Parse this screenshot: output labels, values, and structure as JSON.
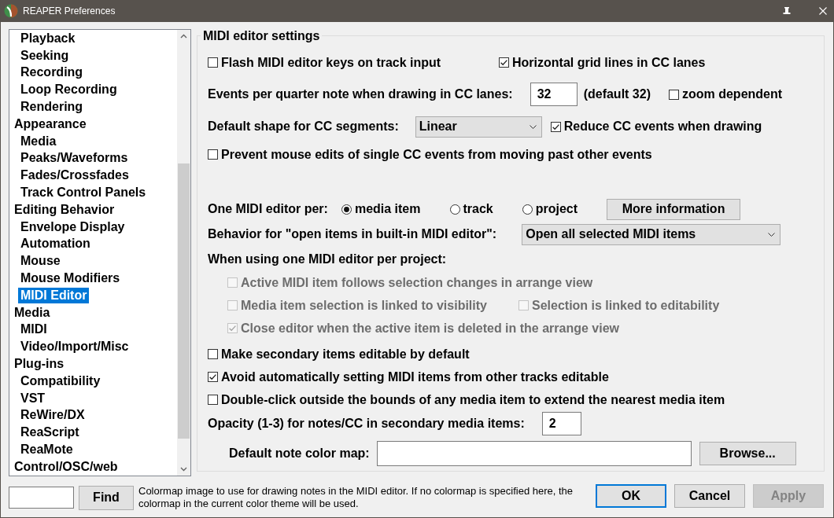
{
  "window": {
    "title": "REAPER Preferences"
  },
  "tree": [
    {
      "children": [
        {
          "label": "Playback",
          "selected": false
        },
        {
          "label": "Seeking",
          "selected": false
        },
        {
          "label": "Recording",
          "selected": false
        },
        {
          "label": "Loop Recording",
          "selected": false
        },
        {
          "label": "Rendering",
          "selected": false
        }
      ]
    },
    {
      "label": "Appearance",
      "selected": false,
      "children": [
        {
          "label": "Media",
          "selected": false
        },
        {
          "label": "Peaks/Waveforms",
          "selected": false
        },
        {
          "label": "Fades/Crossfades",
          "selected": false
        },
        {
          "label": "Track Control Panels",
          "selected": false
        }
      ]
    },
    {
      "label": "Editing Behavior",
      "selected": false,
      "children": [
        {
          "label": "Envelope Display",
          "selected": false
        },
        {
          "label": "Automation",
          "selected": false
        },
        {
          "label": "Mouse",
          "selected": false
        },
        {
          "label": "Mouse Modifiers",
          "selected": false
        },
        {
          "label": "MIDI Editor",
          "selected": true
        }
      ]
    },
    {
      "label": "Media",
      "selected": false,
      "children": [
        {
          "label": "MIDI",
          "selected": false
        },
        {
          "label": "Video/Import/Misc",
          "selected": false
        }
      ]
    },
    {
      "label": "Plug-ins",
      "selected": false,
      "children": [
        {
          "label": "Compatibility",
          "selected": false
        },
        {
          "label": "VST",
          "selected": false
        },
        {
          "label": "ReWire/DX",
          "selected": false
        },
        {
          "label": "ReaScript",
          "selected": false
        },
        {
          "label": "ReaMote",
          "selected": false
        }
      ]
    },
    {
      "label": "Control/OSC/web",
      "selected": false
    }
  ],
  "settings": {
    "title": "MIDI editor settings",
    "rows": [
      {
        "kind": "checks",
        "items": [
          {
            "label": "Flash MIDI editor keys on track input",
            "checked": false,
            "disabled": false
          },
          {
            "label": "Horizontal grid lines in CC lanes",
            "checked": true,
            "disabled": false
          }
        ]
      },
      {
        "kind": "number",
        "label": "Events per quarter note when drawing in CC lanes:",
        "value": "32",
        "note": "(default 32)",
        "option": {
          "label": "zoom dependent",
          "checked": false,
          "disabled": false
        }
      },
      {
        "kind": "dropdown",
        "label": "Default shape for CC segments:",
        "value": "Linear",
        "option": {
          "label": "Reduce CC events when drawing",
          "checked": true,
          "disabled": false
        }
      },
      {
        "kind": "checks",
        "items": [
          {
            "label": "Prevent mouse edits of single CC events from moving past other events",
            "checked": false,
            "disabled": false
          }
        ]
      },
      {
        "kind": "radios",
        "label": "One MIDI editor per:",
        "options": [
          {
            "label": "media item",
            "selected": true
          },
          {
            "label": "track",
            "selected": false
          },
          {
            "label": "project",
            "selected": false
          }
        ],
        "button": "More information"
      },
      {
        "kind": "dropdown",
        "label": "Behavior for \"open items in built-in MIDI editor\":",
        "value": "Open all selected MIDI items"
      },
      {
        "kind": "group",
        "label": "When using one MIDI editor per project:",
        "rows": [
          {
            "kind": "checks",
            "items": [
              {
                "label": "Active MIDI item follows selection changes in arrange view",
                "checked": false,
                "disabled": true
              }
            ]
          },
          {
            "kind": "checks",
            "items": [
              {
                "label": "Media item selection is linked to visibility",
                "checked": false,
                "disabled": true
              },
              {
                "label": "Selection is linked to editability",
                "checked": false,
                "disabled": true
              }
            ]
          },
          {
            "kind": "checks",
            "items": [
              {
                "label": "Close editor when the active item is deleted in the arrange view",
                "checked": true,
                "disabled": true
              }
            ]
          }
        ]
      },
      {
        "kind": "checks",
        "items": [
          {
            "label": "Make secondary items editable by default",
            "checked": false,
            "disabled": false
          }
        ]
      },
      {
        "kind": "checks",
        "items": [
          {
            "label": "Avoid automatically setting MIDI items from other tracks editable",
            "checked": true,
            "disabled": false
          }
        ]
      },
      {
        "kind": "checks",
        "items": [
          {
            "label": "Double-click outside the bounds of any media item to extend the nearest media item",
            "checked": false,
            "disabled": false
          }
        ]
      },
      {
        "kind": "number",
        "label": "Opacity (1-3) for notes/CC in secondary media items:",
        "value": "2"
      },
      {
        "kind": "file",
        "label": "Default note color map:",
        "button": "Browse..."
      }
    ]
  },
  "footer": {
    "find_button": "Find",
    "help": "Colormap image to use for drawing notes in the MIDI editor. If no colormap is specified here, the colormap in the current color theme will be used.",
    "buttons": [
      {
        "label": "OK",
        "default": true,
        "disabled": false
      },
      {
        "label": "Cancel",
        "default": false,
        "disabled": false
      },
      {
        "label": "Apply",
        "default": false,
        "disabled": true
      }
    ]
  }
}
